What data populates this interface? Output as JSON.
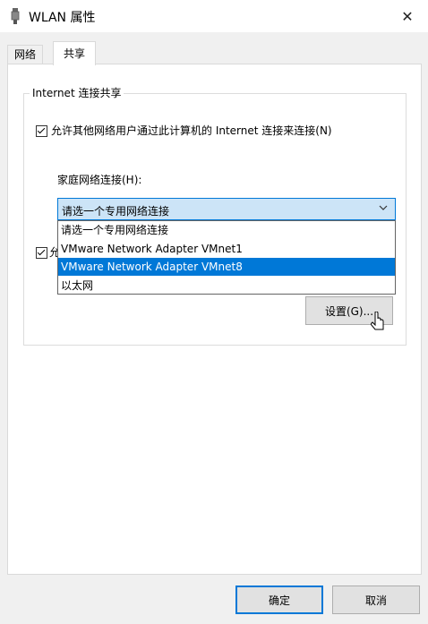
{
  "window": {
    "title": "WLAN 属性",
    "close_glyph": "✕"
  },
  "tabs": [
    {
      "label": "网络"
    },
    {
      "label": "共享"
    }
  ],
  "group": {
    "title": "Internet 连接共享",
    "allow_sharing": {
      "checked": true,
      "label": "允许其他网络用户通过此计算机的 Internet 连接来连接(N)"
    },
    "home_network": {
      "label": "家庭网络连接(H):",
      "selected": "请选一个专用网络连接",
      "options": [
        "请选一个专用网络连接",
        "VMware Network Adapter VMnet1",
        "VMware Network Adapter VMnet8",
        "以太网"
      ],
      "highlighted_index": 2
    },
    "second_checkbox": {
      "checked": true,
      "label_visible": "允"
    },
    "settings_button": "设置(G)..."
  },
  "footer": {
    "ok": "确定",
    "cancel": "取消"
  },
  "icons": {
    "title": "wifi-adapter-icon",
    "chevron": "chevron-down-icon",
    "cursor": "mouse-pointer-icon"
  },
  "colors": {
    "accent": "#0078d7",
    "select_bg": "#cce4f7",
    "dialog_bg": "#f0f0f0"
  }
}
